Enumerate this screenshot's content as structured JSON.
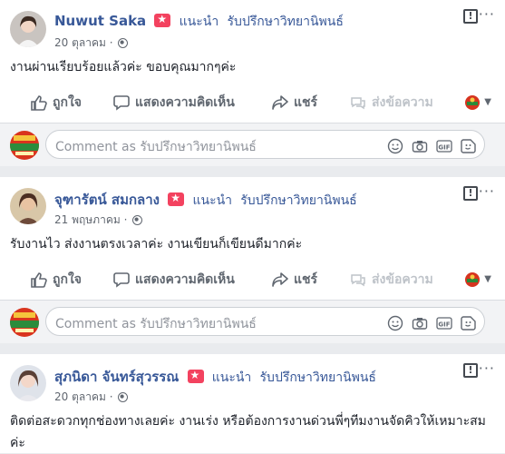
{
  "common": {
    "recommend_label": "แนะนำ",
    "page_name": "รับปรึกษาวิทยานิพนธ์",
    "actions": {
      "like": "ถูกใจ",
      "comment": "แสดงความคิดเห็น",
      "share": "แชร์",
      "message": "ส่งข้อความ"
    },
    "comment_placeholder": "Comment as รับปรึกษาวิทยานิพนธ์",
    "colors": {
      "link": "#385898",
      "badge": "#f3425f",
      "muted": "#606770"
    }
  },
  "posts": [
    {
      "author": "Nuwut Saka",
      "date": "20 ตุลาคม",
      "text": "งานผ่านเรียบร้อยแล้วค่ะ ขอบคุณมากๆค่ะ"
    },
    {
      "author": "จุฑารัตน์ สมกลาง",
      "date": "21 พฤษภาคม",
      "text": "รับงานไว ส่งงานตรงเวลาค่ะ งานเขียนก็เขียนดีมากค่ะ"
    },
    {
      "author": "สุภนิดา จันทร์สุวรรณ",
      "date": "20 ตุลาคม",
      "text": "ติดต่อสะดวกทุกช่องทางเลยค่ะ งานเร่ง หรือต้องการงานด่วนพี่ๆทีมงานจัดคิวให้เหมาะสมค่ะ"
    }
  ]
}
